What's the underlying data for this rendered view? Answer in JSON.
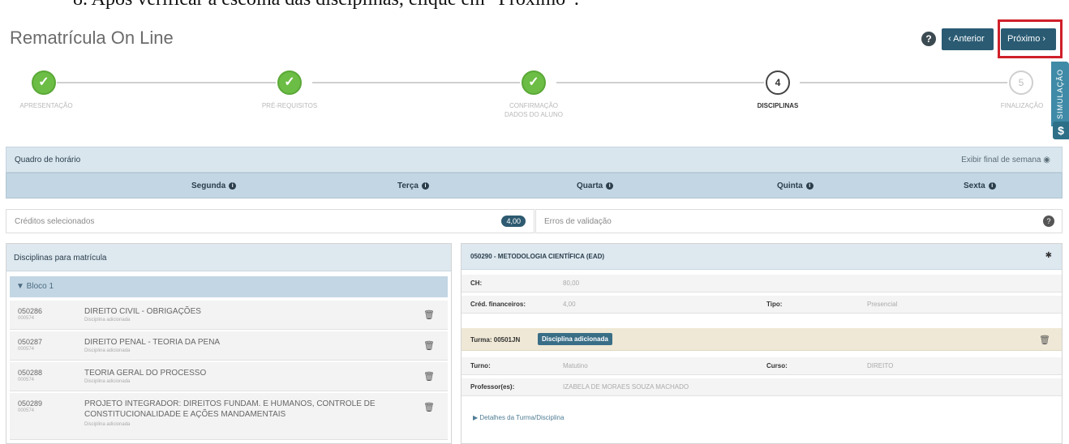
{
  "top_caption": "8. Após verificar a escolha das disciplinas, clique em “Próximo”.",
  "header": {
    "title": "Rematrícula On Line",
    "help_icon": "?",
    "prev_label": "‹ Anterior",
    "next_label": "Próximo ›",
    "side_tab_label": "SIMULAÇÃO",
    "side_tab_icon": "$"
  },
  "steps": [
    {
      "label": "APRESENTAÇÃO",
      "state": "done",
      "icon": "check-icon",
      "symbol": "✓"
    },
    {
      "label": "PRÉ-REQUISITOS",
      "state": "done",
      "icon": "check-icon",
      "symbol": "✓"
    },
    {
      "label": "CONFIRMAÇÃO DADOS DO ALUNO",
      "state": "done",
      "icon": "check-icon",
      "symbol": "✓"
    },
    {
      "label": "DISCIPLINAS",
      "state": "current",
      "number": "4"
    },
    {
      "label": "FINALIZAÇÃO",
      "state": "pending",
      "number": "5"
    }
  ],
  "schedule": {
    "title": "Quadro de horário",
    "right_label": "Exibir final de semana",
    "days": [
      "Segunda",
      "Terça",
      "Quarta",
      "Quinta",
      "Sexta"
    ]
  },
  "credits": {
    "label": "Créditos selecionados",
    "badge": "4,00"
  },
  "validation": {
    "label": "Erros de validação",
    "icon": "?"
  },
  "disciplines_panel": {
    "title": "Disciplinas para matrícula",
    "bloco_label": "▼ Bloco 1",
    "items": [
      {
        "code": "050286",
        "sub": "000574",
        "name": "DIREITO CIVIL - OBRIGAÇÕES",
        "tag": "Disciplina adicionada"
      },
      {
        "code": "050287",
        "sub": "000574",
        "name": "DIREITO PENAL - TEORIA DA PENA",
        "tag": "Disciplina adicionada"
      },
      {
        "code": "050288",
        "sub": "000574",
        "name": "TEORIA GERAL DO PROCESSO",
        "tag": "Disciplina adicionada"
      },
      {
        "code": "050289",
        "sub": "000574",
        "name": "PROJETO INTEGRADOR: DIREITOS FUNDAM. E HUMANOS, CONTROLE DE CONSTITUCIONALIDADE E AÇÕES MANDAMENTAIS",
        "tag": "Disciplina adicionada"
      }
    ]
  },
  "detail_panel": {
    "title": "050290 - METODOLOGIA CIENTÍFICA (EAD)",
    "ch_label": "CH:",
    "ch_value": "80,00",
    "cred_label": "Créd. financeiros:",
    "cred_value": "4,00",
    "tipo_label": "Tipo:",
    "tipo_value": "Presencial",
    "turma_label": "Turma: 00501JN",
    "turma_chip": "Disciplina adicionada",
    "turno_label": "Turno:",
    "turno_value": "Matutino",
    "curso_label": "Curso:",
    "curso_value": "DIREITO",
    "prof_label": "Professor(es):",
    "prof_value": "IZABELA DE MORAES SOUZA MACHADO",
    "details_link": "▶ Detalhes da Turma/Disciplina"
  }
}
